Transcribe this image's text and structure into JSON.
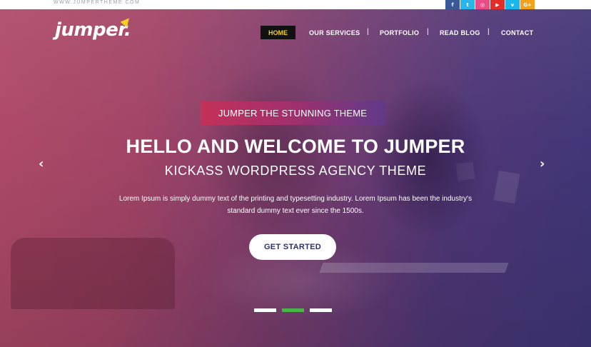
{
  "topbar": {
    "site_url": "WWW.JUMPERTHEME.COM",
    "social": [
      {
        "icon": "facebook-icon",
        "glyph": "f",
        "color": "#3b5998"
      },
      {
        "icon": "twitter-icon",
        "glyph": "t",
        "color": "#29b6e8"
      },
      {
        "icon": "dribbble-icon",
        "glyph": "◎",
        "color": "#ea4c89"
      },
      {
        "icon": "youtube-icon",
        "glyph": "▶",
        "color": "#e52d27"
      },
      {
        "icon": "vimeo-icon",
        "glyph": "v",
        "color": "#1ab7ea"
      },
      {
        "icon": "google-plus-icon",
        "glyph": "G+",
        "color": "#f2a31b"
      }
    ]
  },
  "brand": {
    "logo_text": "jumper.",
    "accent": "#f1d21e"
  },
  "nav": {
    "home": "HOME",
    "services": "OUR SERVICES",
    "portfolio": "PORTFOLIO",
    "blog": "READ BLOG",
    "contact": "CONTACT",
    "separator": "|"
  },
  "hero": {
    "tagline": "JUMPER THE STUNNING THEME",
    "headline": "HELLO AND WELCOME TO JUMPER",
    "subheadline": "KICKASS WORDPRESS AGENCY THEME",
    "description_line1": "Lorem Ipsum is simply dummy text of the printing and typesetting industry. Lorem Ipsum has been the industry's",
    "description_line2": "standard dummy text ever since the 1500s.",
    "cta": "GET STARTED",
    "prev_arrow": "‹",
    "next_arrow": "›",
    "slides_total": 3,
    "active_slide": 2
  }
}
